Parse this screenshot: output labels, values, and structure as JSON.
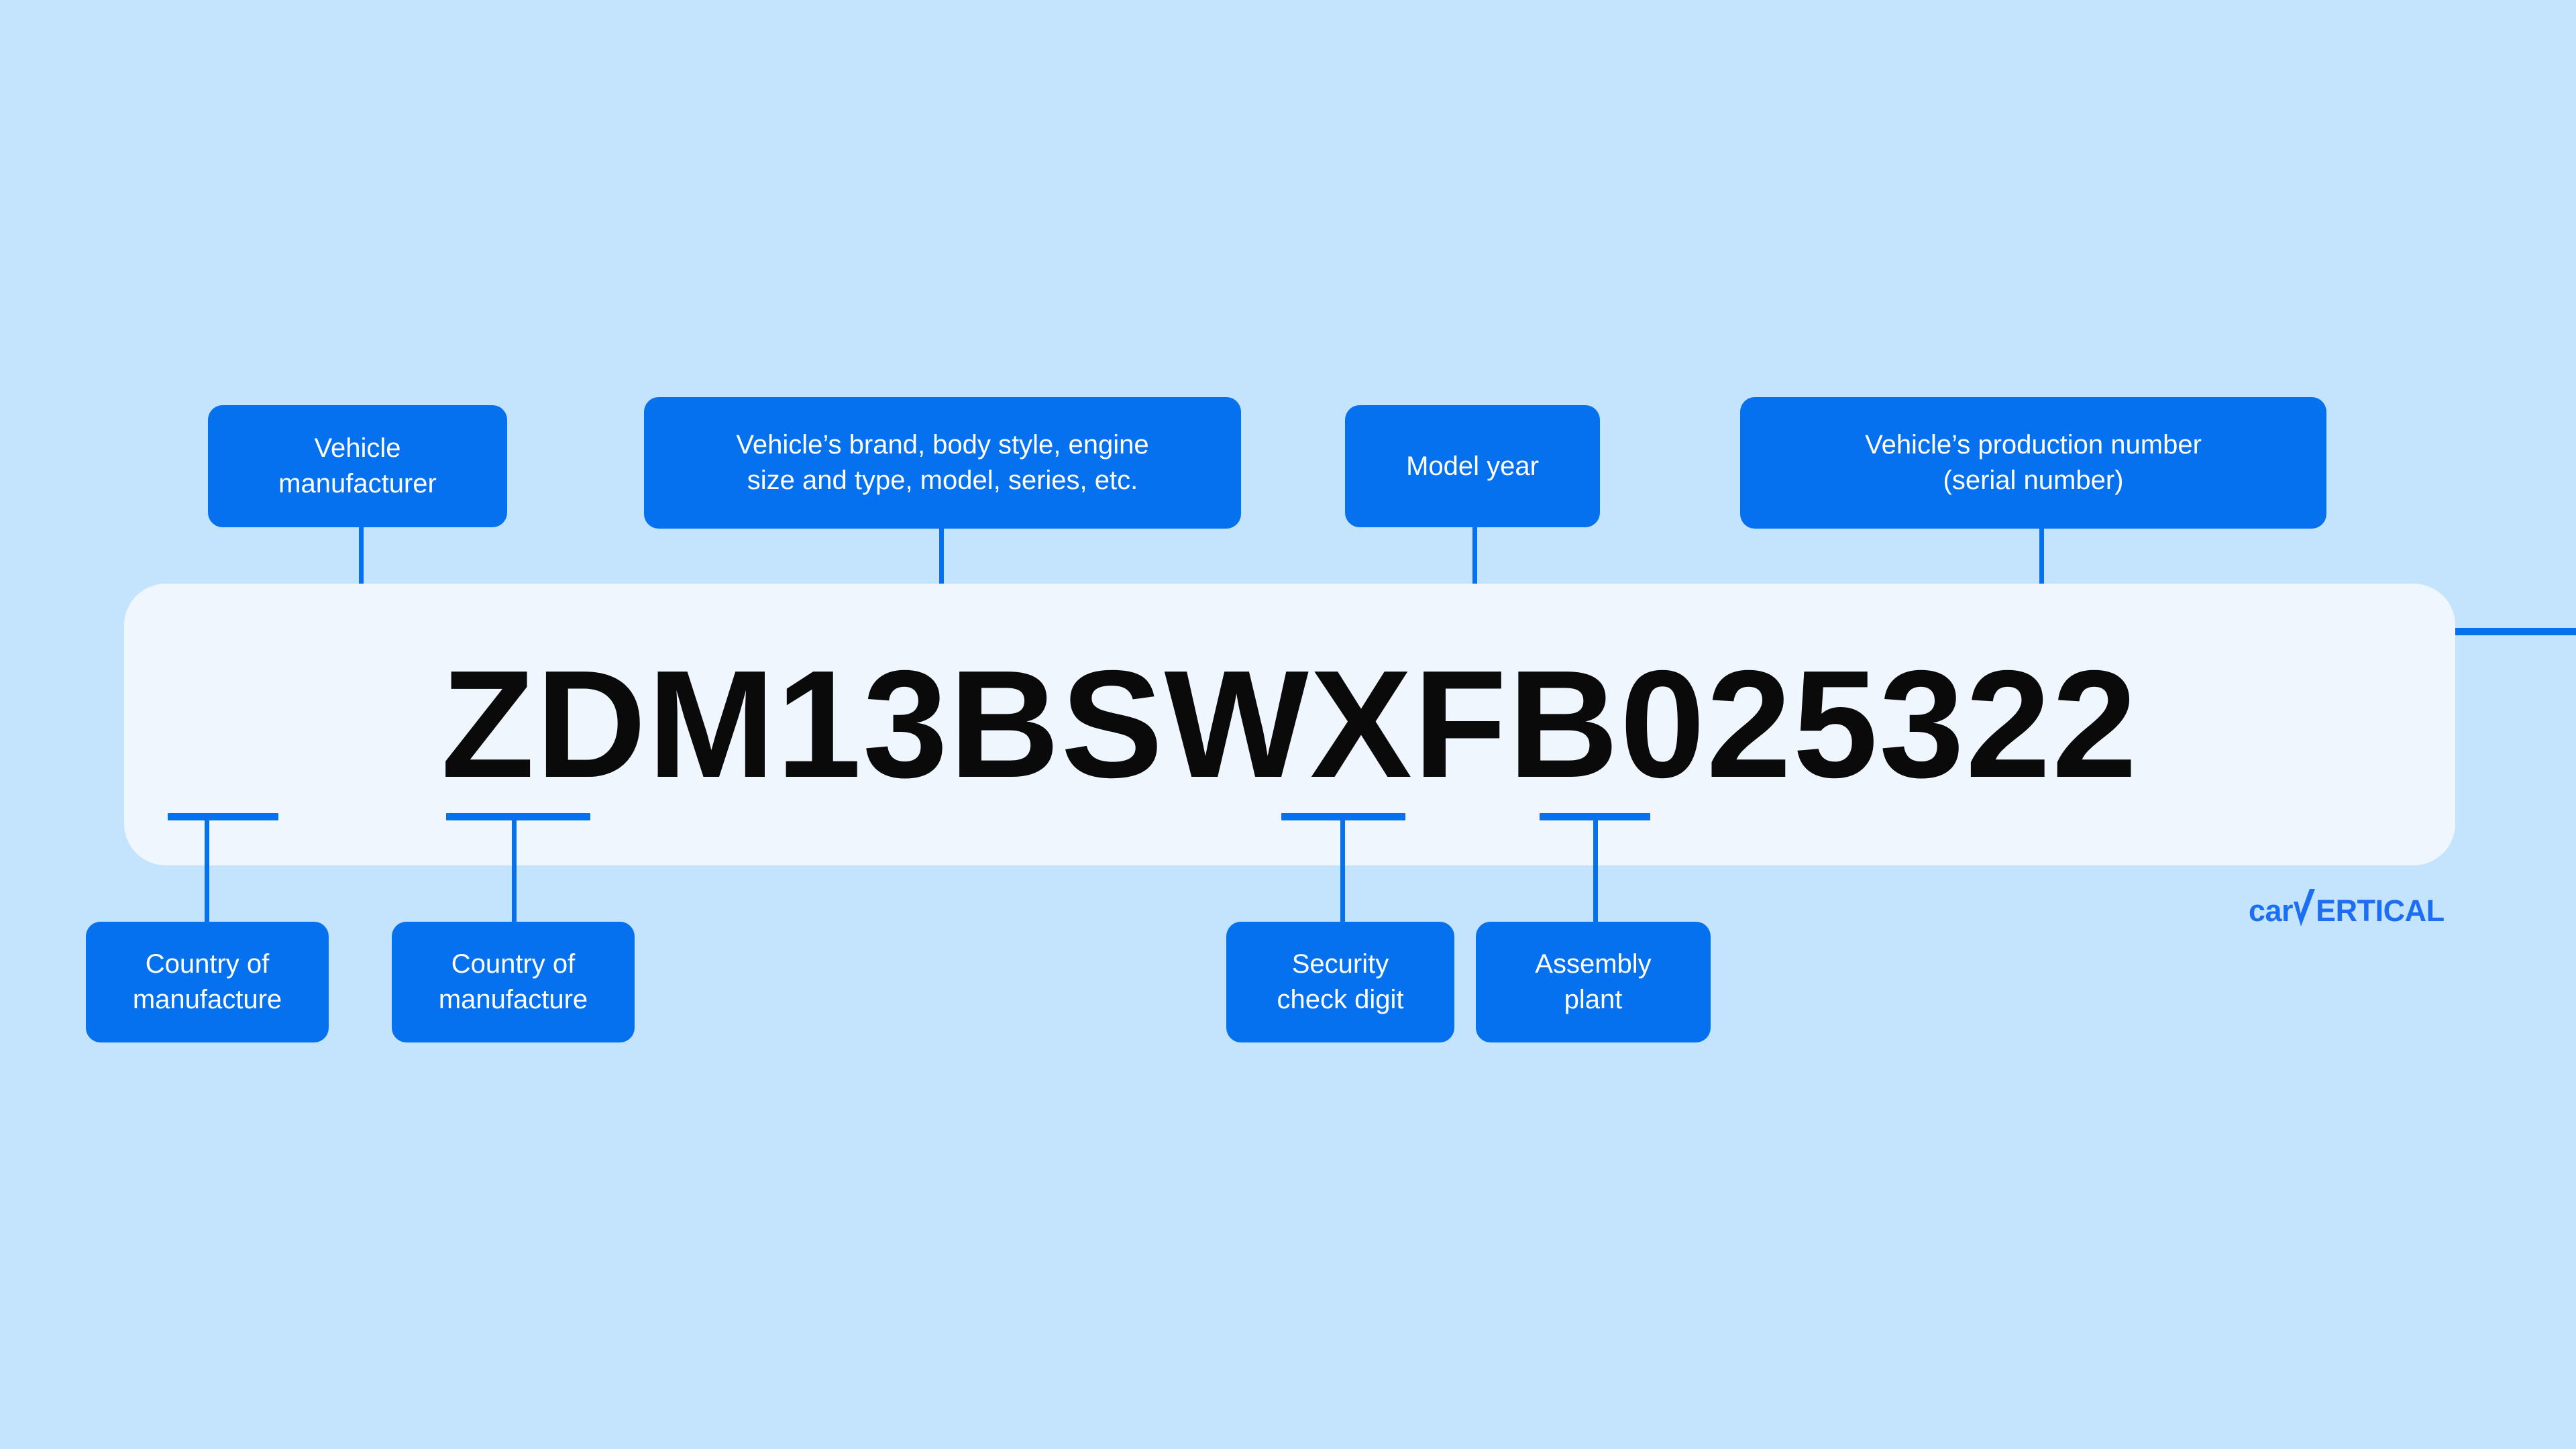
{
  "theme": {
    "background": "#C4E3FD",
    "card": "#EFF6FE",
    "accent": "#0671EE",
    "vin_text": "#0A0A0A",
    "logo": "#1C6EF2"
  },
  "vin": {
    "value": "ZDM13BSWXFB025322",
    "length": 17
  },
  "callouts_top": [
    {
      "id": "vehicle-manufacturer",
      "lines": [
        "Vehicle",
        "manufacturer"
      ],
      "segment": "M (position 3)"
    },
    {
      "id": "vehicle-descriptor",
      "lines": [
        "Vehicle’s brand, body style, engine",
        "size and type, model, series, etc."
      ],
      "segment": "13BSW (positions 4-8)"
    },
    {
      "id": "model-year",
      "lines": [
        "Model year"
      ],
      "segment": "F (position 10)"
    },
    {
      "id": "production-number",
      "lines": [
        "Vehicle’s production number",
        "(serial number)"
      ],
      "segment": "B025322 (positions 11-17)"
    }
  ],
  "callouts_bottom": [
    {
      "id": "country-of-manufacture-1",
      "lines": [
        "Country of",
        "manufacture"
      ],
      "segment": "Z (position 1)"
    },
    {
      "id": "country-of-manufacture-2",
      "lines": [
        "Country of",
        "manufacture"
      ],
      "segment": "D (position 2)"
    },
    {
      "id": "security-check-digit",
      "lines": [
        "Security",
        "check digit"
      ],
      "segment": "X (position 9)"
    },
    {
      "id": "assembly-plant",
      "lines": [
        "Assembly",
        "plant"
      ],
      "segment": "F (position 10)"
    }
  ],
  "logo": {
    "prefix": "car",
    "v": "V",
    "suffix": "ERTICAL",
    "full": "carVERTICAL"
  }
}
